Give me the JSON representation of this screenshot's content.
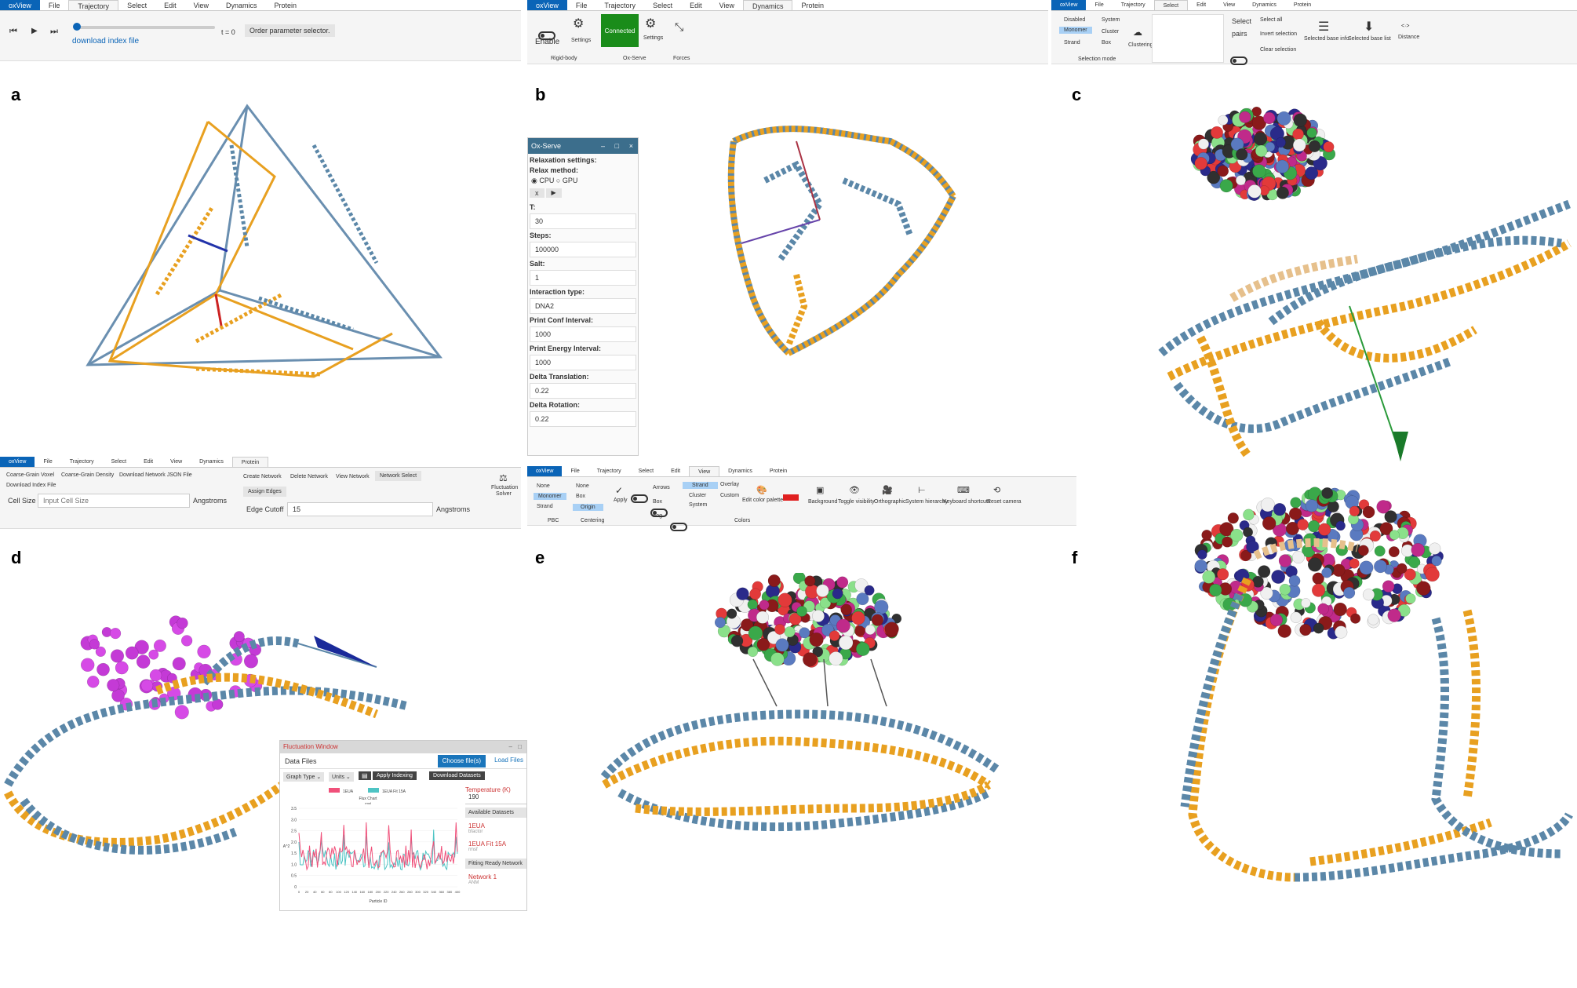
{
  "panel_labels": [
    "a",
    "b",
    "c",
    "d",
    "e",
    "f"
  ],
  "toolbar_a": {
    "tabs": [
      "oxView",
      "File",
      "Trajectory",
      "Select",
      "Edit",
      "View",
      "Dynamics",
      "Protein"
    ],
    "active_tab": "Trajectory",
    "time_label": "t = 0",
    "order_param_button": "Order parameter selector.",
    "download_link": "download index file"
  },
  "toolbar_b": {
    "tabs": [
      "oxView",
      "File",
      "Trajectory",
      "Select",
      "Edit",
      "View",
      "Dynamics",
      "Protein"
    ],
    "active_tab": "Dynamics",
    "rigid_enable": "Enable",
    "rigid_settings": "Settings",
    "connected": "Connected",
    "oxserve_settings": "Settings",
    "groups": [
      "Rigid-body",
      "Ox-Serve",
      "Forces"
    ]
  },
  "toolbar_c": {
    "tabs": [
      "oxView",
      "File",
      "Trajectory",
      "Select",
      "Edit",
      "View",
      "Dynamics",
      "Protein"
    ],
    "active_tab": "Select",
    "modes": [
      "Disabled",
      "Monomer",
      "Strand",
      "System",
      "Cluster",
      "Box"
    ],
    "clustering": "Clustering",
    "select_pairs": [
      "Select",
      "pairs"
    ],
    "actions": [
      "Select all",
      "Invert selection",
      "Clear selection"
    ],
    "base_info": "Selected base info",
    "base_list": "Selected base list",
    "distance": "Distance",
    "group": "Selection mode"
  },
  "ox_serve": {
    "title": "Ox-Serve",
    "heading": "Relaxation settings:",
    "relax_method": "Relax method:",
    "cpu": "CPU",
    "gpu": "GPU",
    "fields": [
      {
        "label": "T:",
        "value": "30"
      },
      {
        "label": "Steps:",
        "value": "100000"
      },
      {
        "label": "Salt:",
        "value": "1"
      },
      {
        "label": "Interaction type:",
        "value": "DNA2"
      },
      {
        "label": "Print Conf Interval:",
        "value": "1000"
      },
      {
        "label": "Print Energy Interval:",
        "value": "1000"
      },
      {
        "label": "Delta Translation:",
        "value": "0.22"
      },
      {
        "label": "Delta Rotation:",
        "value": "0.22"
      }
    ]
  },
  "toolbar_d": {
    "tabs": [
      "oxView",
      "File",
      "Trajectory",
      "Select",
      "Edit",
      "View",
      "Dynamics",
      "Protein"
    ],
    "active_tab": "Protein",
    "items": [
      "Coarse-Grain Voxel",
      "Coarse-Grain Density",
      "Download Network JSON File",
      "Download Index File"
    ],
    "cell_size_label": "Cell Size",
    "cell_size_placeholder": "Input Cell Size",
    "angstroms": "Angstroms",
    "network_buttons": [
      "Create Network",
      "Delete Network",
      "View Network"
    ],
    "network_select": "Network Select",
    "assign_edges": "Assign Edges",
    "edge_cutoff_label": "Edge Cutoff",
    "edge_cutoff_value": "15",
    "fluctuation_solver": [
      "Fluctuation",
      "Solver"
    ]
  },
  "toolbar_e": {
    "tabs": [
      "oxView",
      "File",
      "Trajectory",
      "Select",
      "Edit",
      "View",
      "Dynamics",
      "Protein"
    ],
    "active_tab": "View",
    "pbc": [
      "None",
      "Monomer",
      "Strand"
    ],
    "centering": [
      "None",
      "Box",
      "Origin"
    ],
    "apply": "Apply",
    "toggles": [
      "Arrows",
      "Box",
      "Fog"
    ],
    "colors": [
      "Strand",
      "Cluster",
      "System",
      "Overlay",
      "Custom"
    ],
    "edit_palette": "Edit color palette",
    "tools": [
      "Background",
      "Toggle visibility",
      "Orthographic",
      "System hierarchy",
      "Keyboard shortcuts",
      "Reset camera"
    ],
    "groups": [
      "PBC",
      "Centering",
      "Colors"
    ]
  },
  "fluct_window": {
    "title": "Fluctuation Window",
    "data_files": "Data Files",
    "choose": "Choose file(s)",
    "load": "Load Files",
    "graph_type": "Graph Type",
    "units": "Units",
    "apply_indexing": "Apply Indexing",
    "download_datasets": "Download Datasets",
    "temperature": "Temperature (K)",
    "temp_value": "190",
    "available": "Available Datasets",
    "datasets": [
      {
        "name": "1EUA",
        "sub": "bfactor"
      },
      {
        "name": "1EUA Fit 15A",
        "sub": "rmsf"
      }
    ],
    "fitting": "Fitting Ready Network",
    "network": {
      "name": "Network 1",
      "sub": "ANM"
    }
  },
  "chart_data": {
    "type": "line",
    "title": "Flux Chart",
    "subtitle": "rmsf",
    "xlabel": "Particle ID",
    "ylabel": "A^2",
    "ylim": [
      0,
      3.5
    ],
    "yticks": [
      "0",
      "0.5",
      "1.0",
      "1.5",
      "2.0",
      "2.5",
      "3.0",
      "3.5"
    ],
    "xticks": [
      "0",
      "20",
      "40",
      "60",
      "80",
      "100",
      "120",
      "140",
      "160",
      "180",
      "200",
      "220",
      "240",
      "260",
      "280",
      "300",
      "320",
      "340",
      "360",
      "380",
      "400"
    ],
    "series": [
      {
        "name": "1EUA",
        "color": "#f0507a"
      },
      {
        "name": "1EUA Fit 15A",
        "color": "#4ec4c4"
      }
    ]
  }
}
